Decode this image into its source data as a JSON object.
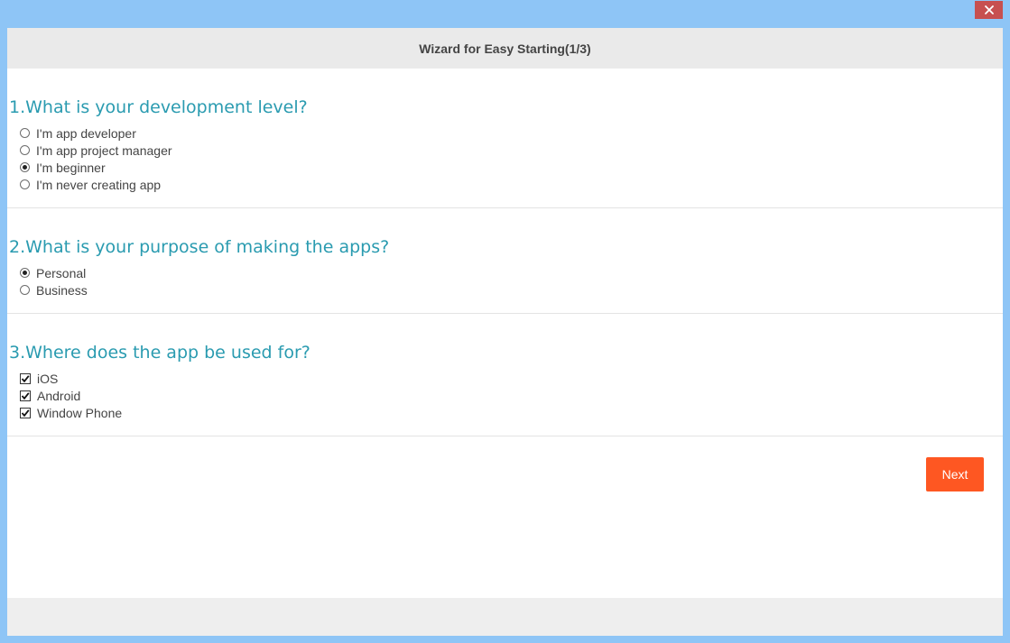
{
  "window": {
    "title": "Wizard for Easy Starting(1/3)",
    "close_icon": "close-icon",
    "accent_color": "#8ec5f6",
    "close_color": "#c75050"
  },
  "questions": [
    {
      "title": "1.What is your development level?",
      "type": "radio",
      "options": [
        {
          "label": "I'm app developer",
          "checked": false
        },
        {
          "label": "I'm app project manager",
          "checked": false
        },
        {
          "label": "I'm beginner",
          "checked": true
        },
        {
          "label": "I'm never creating app",
          "checked": false
        }
      ]
    },
    {
      "title": "2.What is your purpose of making the apps?",
      "type": "radio",
      "options": [
        {
          "label": "Personal",
          "checked": true
        },
        {
          "label": "Business",
          "checked": false
        }
      ]
    },
    {
      "title": "3.Where does the app be used for?",
      "type": "checkbox",
      "options": [
        {
          "label": "iOS",
          "checked": true
        },
        {
          "label": "Android",
          "checked": true
        },
        {
          "label": "Window Phone",
          "checked": true
        }
      ]
    }
  ],
  "actions": {
    "next_label": "Next",
    "next_color": "#fe5722"
  },
  "colors": {
    "question_text": "#2a9bb0",
    "header_bg": "#eaeaea"
  }
}
